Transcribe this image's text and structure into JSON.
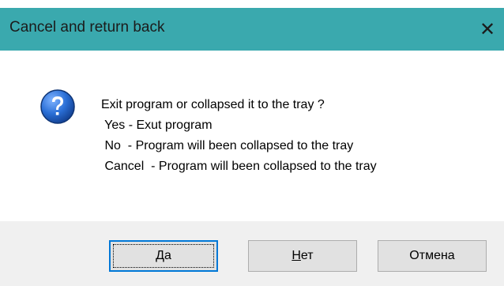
{
  "window": {
    "title": "Cancel and return back",
    "close_glyph": "✕"
  },
  "message": {
    "lines": [
      "Exit program or collapsed it to the tray ?",
      " Yes - Exut program",
      " No  - Program will been collapsed to the tray",
      " Cancel  - Program will been collapsed to the tray"
    ],
    "icon": "question-icon"
  },
  "buttons": {
    "yes": {
      "mnemonic": "Д",
      "rest": "а"
    },
    "no": {
      "mnemonic": "Н",
      "rest": "ет"
    },
    "cancel": {
      "label": "Отмена"
    }
  },
  "colors": {
    "titlebar": "#3aa9ae",
    "footer": "#f0f0f0",
    "default_button_border": "#0078d7",
    "icon_blue": "#1f5fb4"
  }
}
